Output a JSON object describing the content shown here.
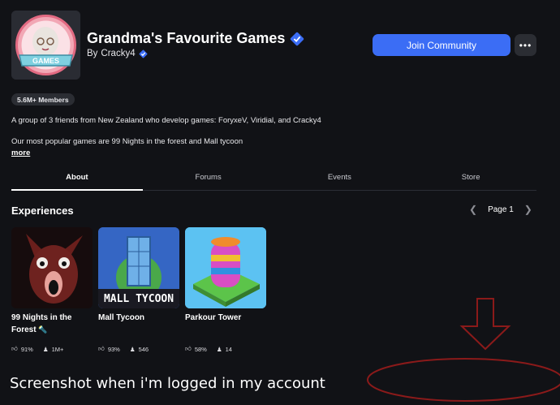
{
  "group": {
    "title": "Grandma's Favourite Games",
    "by_prefix": "By",
    "owner": "Cracky4",
    "logo_text": "GAMES",
    "members_badge": "5.6M+ Members",
    "join_label": "Join Community",
    "more_menu_label": "•••",
    "description_line1": "A group of 3 friends from New Zealand who develop games: ForyxeV, Viridial, and Cracky4",
    "description_line2": "Our most popular games are 99 Nights in the forest and Mall tycoon",
    "more_link": "more"
  },
  "tabs": [
    {
      "label": "About",
      "active": true
    },
    {
      "label": "Forums",
      "active": false
    },
    {
      "label": "Events",
      "active": false
    },
    {
      "label": "Store",
      "active": false
    }
  ],
  "experiences": {
    "heading": "Experiences",
    "page_label": "Page 1",
    "games": [
      {
        "name": "99 Nights in the Forest",
        "rating": "91%",
        "players": "1M+",
        "thumb_icon": "deer-monster-icon"
      },
      {
        "name": "Mall Tycoon",
        "thumb_text": "MALL TYCOON",
        "rating": "93%",
        "players": "546",
        "thumb_icon": "skyscraper-icon"
      },
      {
        "name": "Parkour Tower",
        "rating": "58%",
        "players": "14",
        "thumb_icon": "tower-icon"
      }
    ]
  },
  "annotation": {
    "caption": "Screenshot when i'm logged in my account",
    "color": "#8b1a1a"
  },
  "colors": {
    "background": "#111216",
    "accent": "#3b6df5",
    "verified": "#3b6df5"
  }
}
